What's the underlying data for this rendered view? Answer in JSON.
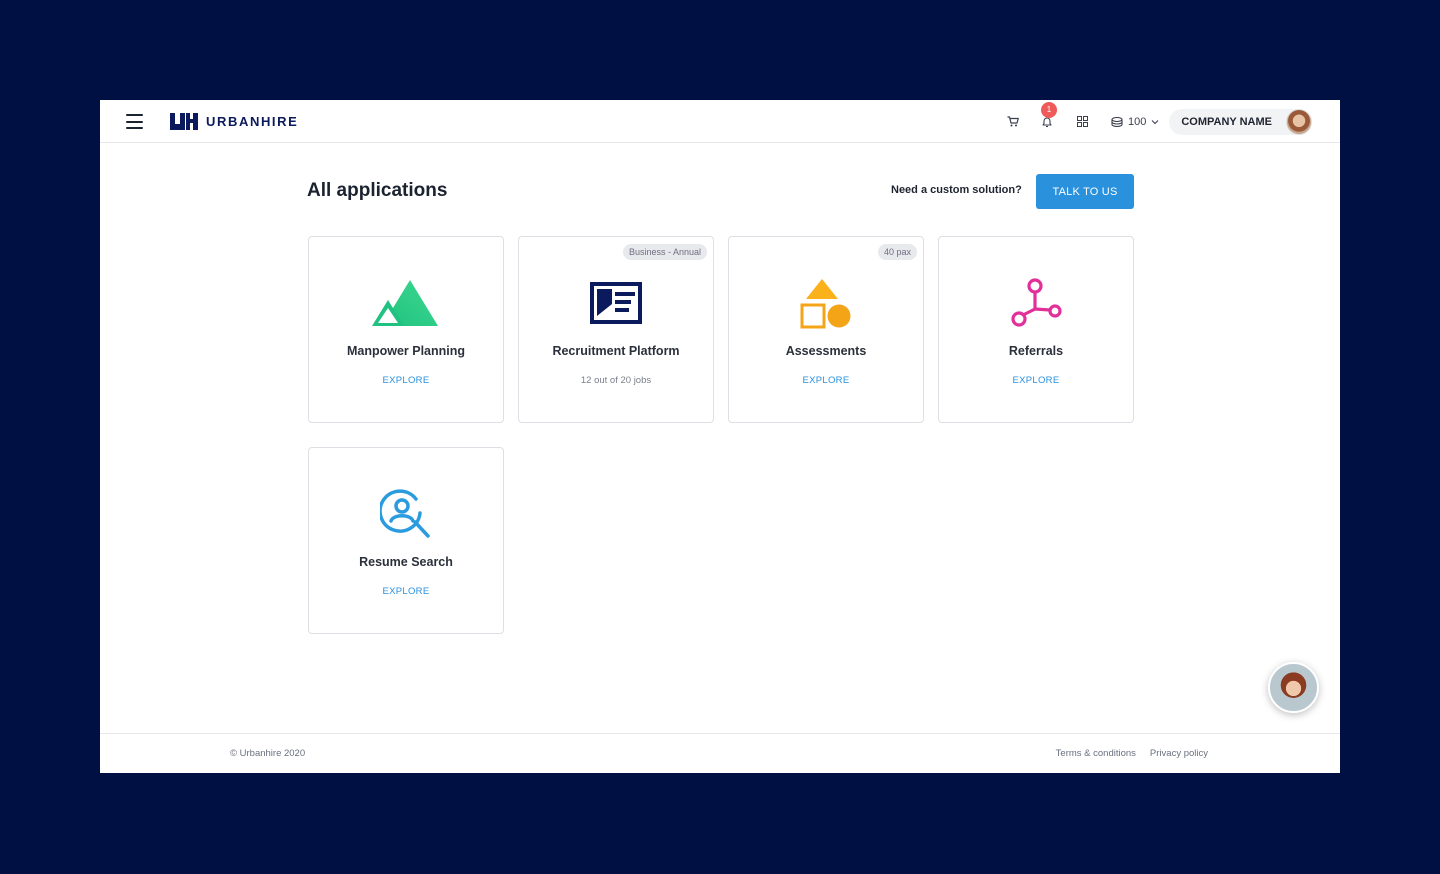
{
  "brand": {
    "name": "URBANHIRE",
    "accent": "#2a91dd",
    "navy": "#0b1a5c"
  },
  "header": {
    "menu_icon": "hamburger-menu-icon",
    "icons": [
      "cart-icon",
      "bell-icon",
      "apps-grid-icon",
      "credits-icon"
    ],
    "notification_count": "1",
    "credits": "100",
    "company_name": "COMPANY NAME"
  },
  "main": {
    "title": "All applications",
    "custom_question": "Need a custom solution?",
    "cta_label": "TALK TO US"
  },
  "apps": [
    {
      "title": "Manpower Planning",
      "sub": "EXPLORE",
      "icon": "mountains-icon",
      "badge": ""
    },
    {
      "title": "Recruitment Platform",
      "sub": "12 out of 20 jobs",
      "icon": "newspaper-icon",
      "badge": "Business - Annual"
    },
    {
      "title": "Assessments",
      "sub": "EXPLORE",
      "icon": "shapes-icon",
      "badge": "40 pax"
    },
    {
      "title": "Referrals",
      "sub": "EXPLORE",
      "icon": "network-icon",
      "badge": ""
    },
    {
      "title": "Resume Search",
      "sub": "EXPLORE",
      "icon": "person-search-icon",
      "badge": ""
    }
  ],
  "footer": {
    "copyright": "© Urbanhire 2020",
    "links": [
      "Terms & conditions",
      "Privacy policy"
    ]
  }
}
